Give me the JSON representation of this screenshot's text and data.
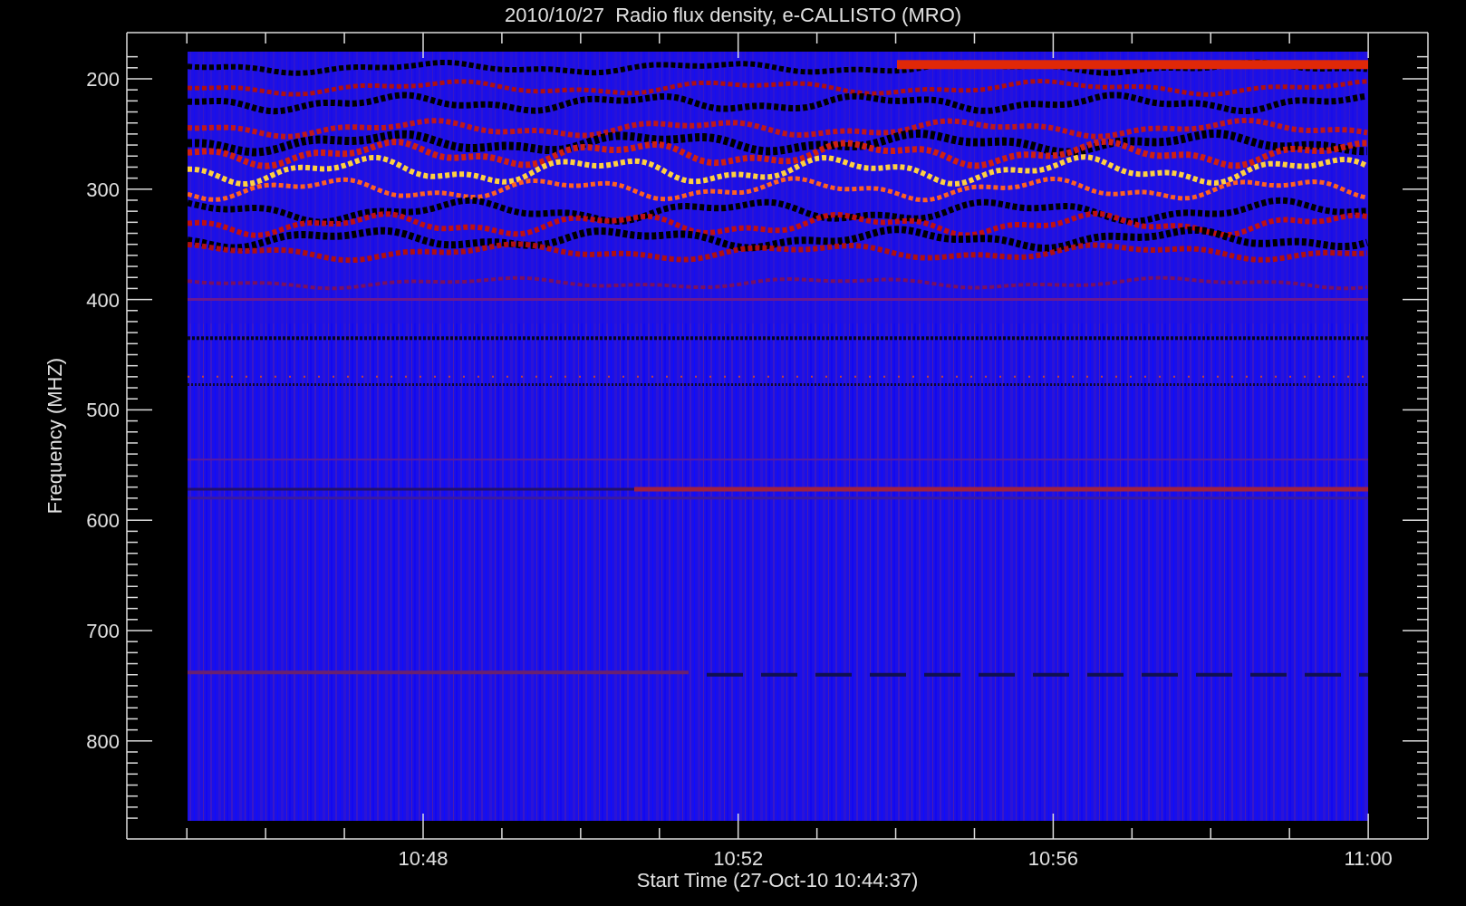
{
  "title": "2010/10/27  Radio flux density, e-CALLISTO (MRO)",
  "y_axis": {
    "label": "Frequency (MHZ)",
    "ticks": [
      "200",
      "300",
      "400",
      "500",
      "600",
      "700",
      "800"
    ]
  },
  "x_axis": {
    "label": "Start Time (27-Oct-10 10:44:37)",
    "ticks": [
      "10:48",
      "10:52",
      "10:56",
      "11:00"
    ]
  }
}
